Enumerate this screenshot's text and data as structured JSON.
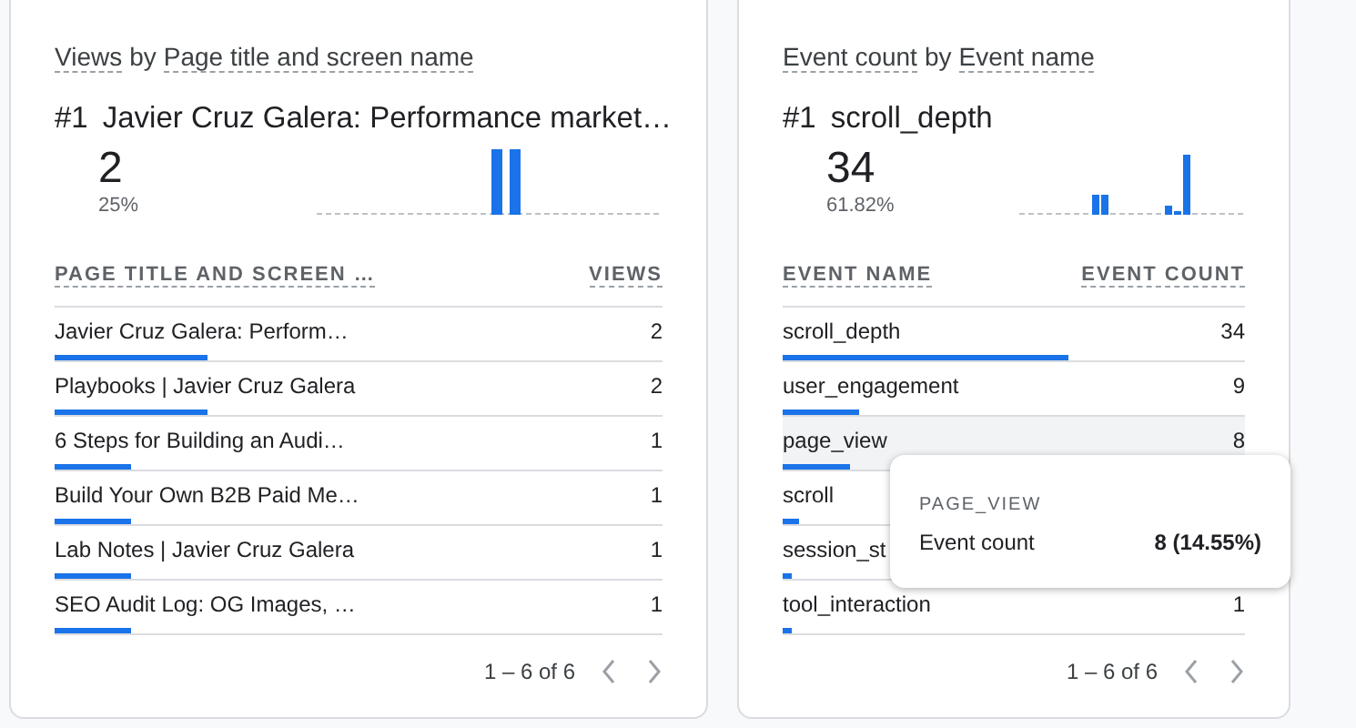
{
  "cards": [
    {
      "title": {
        "metric": "Views",
        "connector": "by",
        "dimension": "Page title and screen name"
      },
      "top": {
        "rank": "#1",
        "name": "Javier Cruz Galera: Performance market…",
        "value": "2",
        "share": "25%"
      },
      "columns": [
        "PAGE TITLE AND SCREEN …",
        "VIEWS"
      ],
      "rows": [
        {
          "name": "Javier Cruz Galera: Perform…",
          "value": "2",
          "level": 0.25,
          "highlighted": false
        },
        {
          "name": "Playbooks | Javier Cruz Galera",
          "value": "2",
          "level": 0.25,
          "highlighted": false
        },
        {
          "name": "6 Steps for Building an Audi…",
          "value": "1",
          "level": 0.125,
          "highlighted": false
        },
        {
          "name": "Build Your Own B2B Paid Me…",
          "value": "1",
          "level": 0.125,
          "highlighted": false
        },
        {
          "name": "Lab Notes | Javier Cruz Galera",
          "value": "1",
          "level": 0.125,
          "highlighted": false
        },
        {
          "name": "SEO Audit Log: OG Images, …",
          "value": "1",
          "level": 0.125,
          "highlighted": false
        }
      ],
      "pagination": "1 – 6 of 6"
    },
    {
      "title": {
        "metric": "Event count",
        "connector": "by",
        "dimension": "Event name"
      },
      "top": {
        "rank": "#1",
        "name": "scroll_depth",
        "value": "34",
        "share": "61.82%"
      },
      "columns": [
        "EVENT NAME",
        "EVENT COUNT"
      ],
      "rows": [
        {
          "name": "scroll_depth",
          "value": "34",
          "level": 0.618,
          "highlighted": false
        },
        {
          "name": "user_engagement",
          "value": "9",
          "level": 0.164,
          "highlighted": false
        },
        {
          "name": "page_view",
          "value": "8",
          "level": 0.145,
          "highlighted": true
        },
        {
          "name": "scroll",
          "level": 0.036,
          "highlighted": false
        },
        {
          "name": "session_st",
          "level": 0.018,
          "highlighted": false
        },
        {
          "name": "tool_interaction",
          "value": "1",
          "level": 0.018,
          "highlighted": false
        }
      ],
      "pagination": "1 – 6 of 6",
      "tooltip": {
        "title": "PAGE_VIEW",
        "label": "Event count",
        "value": "8 (14.55%)"
      }
    }
  ]
}
